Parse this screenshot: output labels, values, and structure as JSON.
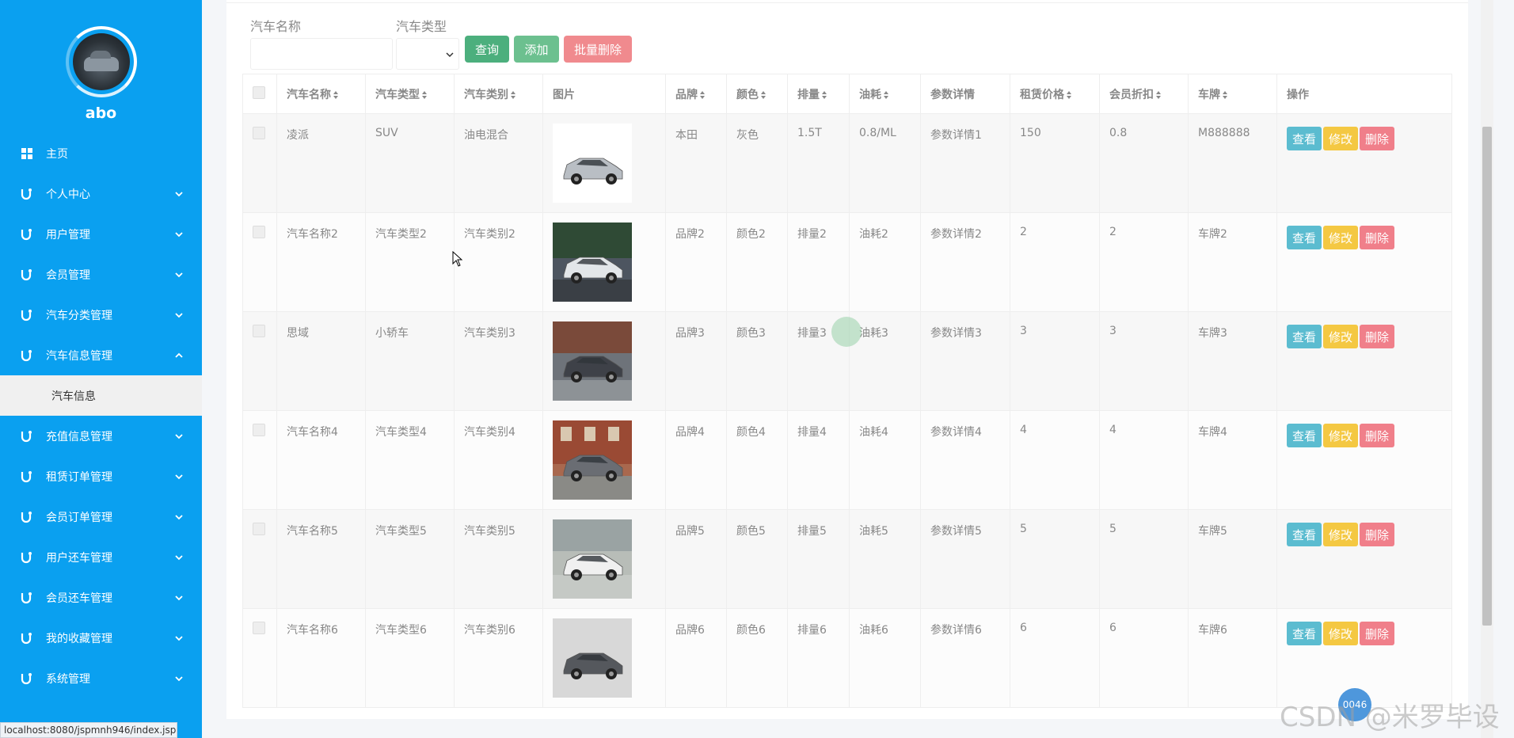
{
  "sidebar": {
    "username": "abo",
    "items": [
      {
        "label": "主页",
        "icon": "dashboard-icon",
        "chevron": "none"
      },
      {
        "label": "个人中心",
        "icon": "menu-icon",
        "chevron": "down"
      },
      {
        "label": "用户管理",
        "icon": "menu-icon",
        "chevron": "down"
      },
      {
        "label": "会员管理",
        "icon": "menu-icon",
        "chevron": "down"
      },
      {
        "label": "汽车分类管理",
        "icon": "menu-icon",
        "chevron": "down"
      },
      {
        "label": "汽车信息管理",
        "icon": "menu-icon",
        "chevron": "up"
      },
      {
        "label": "充值信息管理",
        "icon": "menu-icon",
        "chevron": "down"
      },
      {
        "label": "租赁订单管理",
        "icon": "menu-icon",
        "chevron": "down"
      },
      {
        "label": "会员订单管理",
        "icon": "menu-icon",
        "chevron": "down"
      },
      {
        "label": "用户还车管理",
        "icon": "menu-icon",
        "chevron": "down"
      },
      {
        "label": "会员还车管理",
        "icon": "menu-icon",
        "chevron": "down"
      },
      {
        "label": "我的收藏管理",
        "icon": "menu-icon",
        "chevron": "down"
      },
      {
        "label": "系统管理",
        "icon": "menu-icon",
        "chevron": "down"
      }
    ],
    "submenu_active": "汽车信息"
  },
  "search": {
    "name_label": "汽车名称",
    "name_value": "",
    "type_label": "汽车类型",
    "type_value": "",
    "query_btn": "查询",
    "add_btn": "添加",
    "batch_delete_btn": "批量删除"
  },
  "table": {
    "headers": [
      "汽车名称",
      "汽车类型",
      "汽车类别",
      "图片",
      "品牌",
      "颜色",
      "排量",
      "油耗",
      "参数详情",
      "租赁价格",
      "会员折扣",
      "车牌",
      "操作"
    ],
    "rows": [
      {
        "name": "凌派",
        "type": "SUV",
        "category": "油电混合",
        "image": "car-photo-1",
        "brand": "本田",
        "color": "灰色",
        "displacement": "1.5T",
        "fuel": "0.8/ML",
        "detail": "参数详情1",
        "price": "150",
        "discount": "0.8",
        "plate": "M888888"
      },
      {
        "name": "汽车名称2",
        "type": "汽车类型2",
        "category": "汽车类别2",
        "image": "car-photo-2",
        "brand": "品牌2",
        "color": "颜色2",
        "displacement": "排量2",
        "fuel": "油耗2",
        "detail": "参数详情2",
        "price": "2",
        "discount": "2",
        "plate": "车牌2"
      },
      {
        "name": "思域",
        "type": "小轿车",
        "category": "汽车类别3",
        "image": "car-photo-3",
        "brand": "品牌3",
        "color": "颜色3",
        "displacement": "排量3",
        "fuel": "油耗3",
        "detail": "参数详情3",
        "price": "3",
        "discount": "3",
        "plate": "车牌3"
      },
      {
        "name": "汽车名称4",
        "type": "汽车类型4",
        "category": "汽车类别4",
        "image": "car-photo-4",
        "brand": "品牌4",
        "color": "颜色4",
        "displacement": "排量4",
        "fuel": "油耗4",
        "detail": "参数详情4",
        "price": "4",
        "discount": "4",
        "plate": "车牌4"
      },
      {
        "name": "汽车名称5",
        "type": "汽车类型5",
        "category": "汽车类别5",
        "image": "car-photo-5",
        "brand": "品牌5",
        "color": "颜色5",
        "displacement": "排量5",
        "fuel": "油耗5",
        "detail": "参数详情5",
        "price": "5",
        "discount": "5",
        "plate": "车牌5"
      },
      {
        "name": "汽车名称6",
        "type": "汽车类型6",
        "category": "汽车类别6",
        "image": "car-photo-6",
        "brand": "品牌6",
        "color": "颜色6",
        "displacement": "排量6",
        "fuel": "油耗6",
        "detail": "参数详情6",
        "price": "6",
        "discount": "6",
        "plate": "车牌6"
      }
    ],
    "actions": {
      "view": "查看",
      "edit": "修改",
      "delete": "删除"
    }
  },
  "statusbar": {
    "url": "localhost:8080/jspmnh946/index.jsp#"
  },
  "watermark": "CSDN @米罗毕设",
  "float_badge": "0046",
  "colors": {
    "sidebar_bg": "#0aa0f0",
    "query": "#4caf7d",
    "add": "#6cc08f",
    "batch_delete": "#f08a8e",
    "view": "#5bbcd0",
    "edit": "#f4c842",
    "delete": "#f07f8a"
  }
}
